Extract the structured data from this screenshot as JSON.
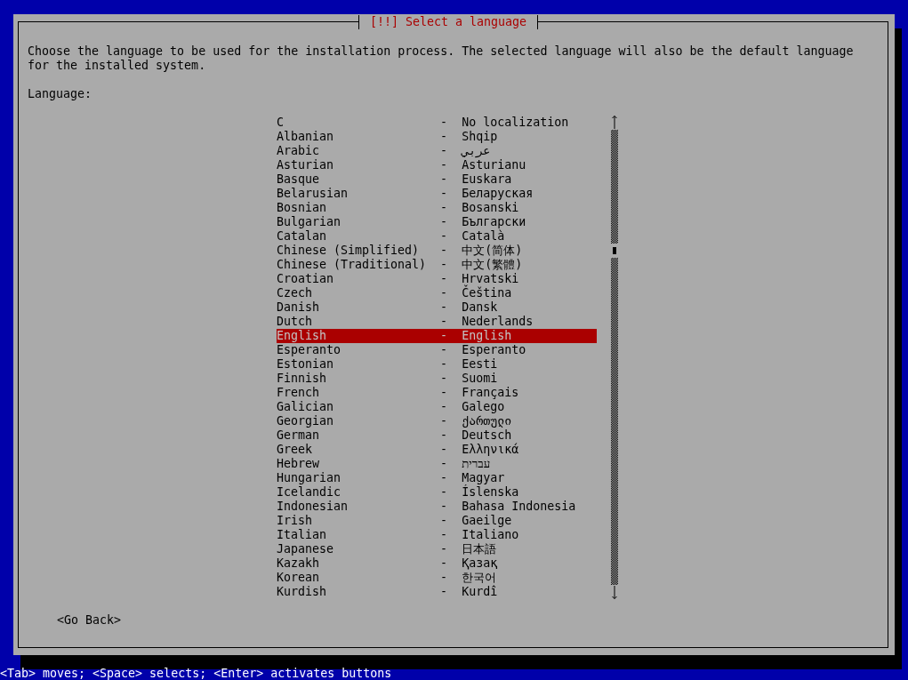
{
  "dialog": {
    "title": "[!!] Select a language",
    "prompt": "Choose the language to be used for the installation process. The selected language will also be the default language for the installed system.",
    "list_label": "Language:",
    "languages": [
      {
        "name": "C",
        "separator": "-",
        "native": "No localization",
        "selected": false
      },
      {
        "name": "Albanian",
        "separator": "-",
        "native": "Shqip",
        "selected": false
      },
      {
        "name": "Arabic",
        "separator": "-",
        "native": "عربي",
        "selected": false
      },
      {
        "name": "Asturian",
        "separator": "-",
        "native": "Asturianu",
        "selected": false
      },
      {
        "name": "Basque",
        "separator": "-",
        "native": "Euskara",
        "selected": false
      },
      {
        "name": "Belarusian",
        "separator": "-",
        "native": "Беларуская",
        "selected": false
      },
      {
        "name": "Bosnian",
        "separator": "-",
        "native": "Bosanski",
        "selected": false
      },
      {
        "name": "Bulgarian",
        "separator": "-",
        "native": "Български",
        "selected": false
      },
      {
        "name": "Catalan",
        "separator": "-",
        "native": "Català",
        "selected": false
      },
      {
        "name": "Chinese (Simplified)",
        "separator": "-",
        "native": "中文(简体)",
        "selected": false
      },
      {
        "name": "Chinese (Traditional)",
        "separator": "-",
        "native": "中文(繁體)",
        "selected": false
      },
      {
        "name": "Croatian",
        "separator": "-",
        "native": "Hrvatski",
        "selected": false
      },
      {
        "name": "Czech",
        "separator": "-",
        "native": "Čeština",
        "selected": false
      },
      {
        "name": "Danish",
        "separator": "-",
        "native": "Dansk",
        "selected": false
      },
      {
        "name": "Dutch",
        "separator": "-",
        "native": "Nederlands",
        "selected": false
      },
      {
        "name": "English",
        "separator": "-",
        "native": "English",
        "selected": true
      },
      {
        "name": "Esperanto",
        "separator": "-",
        "native": "Esperanto",
        "selected": false
      },
      {
        "name": "Estonian",
        "separator": "-",
        "native": "Eesti",
        "selected": false
      },
      {
        "name": "Finnish",
        "separator": "-",
        "native": "Suomi",
        "selected": false
      },
      {
        "name": "French",
        "separator": "-",
        "native": "Français",
        "selected": false
      },
      {
        "name": "Galician",
        "separator": "-",
        "native": "Galego",
        "selected": false
      },
      {
        "name": "Georgian",
        "separator": "-",
        "native": "ქართული",
        "selected": false
      },
      {
        "name": "German",
        "separator": "-",
        "native": "Deutsch",
        "selected": false
      },
      {
        "name": "Greek",
        "separator": "-",
        "native": "Ελληνικά",
        "selected": false
      },
      {
        "name": "Hebrew",
        "separator": "-",
        "native": "עברית",
        "selected": false
      },
      {
        "name": "Hungarian",
        "separator": "-",
        "native": "Magyar",
        "selected": false
      },
      {
        "name": "Icelandic",
        "separator": "-",
        "native": "Íslenska",
        "selected": false
      },
      {
        "name": "Indonesian",
        "separator": "-",
        "native": "Bahasa Indonesia",
        "selected": false
      },
      {
        "name": "Irish",
        "separator": "-",
        "native": "Gaeilge",
        "selected": false
      },
      {
        "name": "Italian",
        "separator": "-",
        "native": "Italiano",
        "selected": false
      },
      {
        "name": "Japanese",
        "separator": "-",
        "native": "日本語",
        "selected": false
      },
      {
        "name": "Kazakh",
        "separator": "-",
        "native": "Қазақ",
        "selected": false
      },
      {
        "name": "Korean",
        "separator": "-",
        "native": "한국어",
        "selected": false
      },
      {
        "name": "Kurdish",
        "separator": "-",
        "native": "Kurdî",
        "selected": false
      }
    ],
    "buttons": [
      "<Go Back>"
    ]
  },
  "status_bar": "<Tab> moves; <Space> selects; <Enter> activates buttons"
}
